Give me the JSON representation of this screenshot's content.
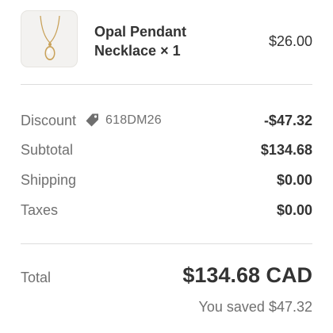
{
  "product": {
    "name_line1": "Opal Pendant",
    "name_line2": "Necklace × 1",
    "price": "$26.00",
    "image_icon": "necklace-image"
  },
  "summary": {
    "discount": {
      "label": "Discount",
      "code": "618DM26",
      "icon": "tag-icon",
      "value": "-$47.32"
    },
    "subtotal": {
      "label": "Subtotal",
      "value": "$134.68"
    },
    "shipping": {
      "label": "Shipping",
      "value": "$0.00"
    },
    "taxes": {
      "label": "Taxes",
      "value": "$0.00"
    }
  },
  "total": {
    "label": "Total",
    "value": "$134.68 CAD",
    "saved_text": "You saved $47.32"
  }
}
